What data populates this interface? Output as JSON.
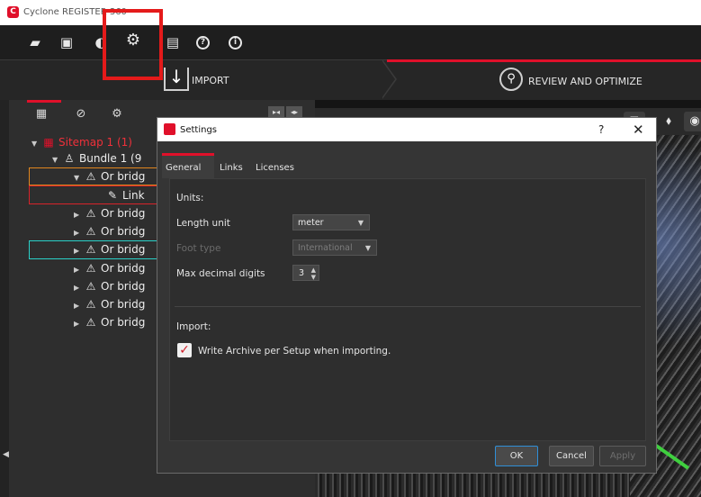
{
  "app": {
    "title": "Cyclone REGISTER 360"
  },
  "toolbar": {
    "icons": [
      "folder-open-icon",
      "archive-icon",
      "half-circle-icon",
      "settings-gear-icon",
      "document-icon",
      "help-icon",
      "info-icon"
    ]
  },
  "workflow": {
    "import_label": "IMPORT",
    "review_label": "REVIEW AND OPTIMIZE"
  },
  "tree": {
    "sitemap": "Sitemap 1 (1)",
    "bundle": "Bundle 1 (9",
    "items": [
      {
        "label": "Or bridg",
        "expanded": true
      },
      {
        "label": "Link",
        "type": "link"
      },
      {
        "label": "Or bridg"
      },
      {
        "label": "Or bridg"
      },
      {
        "label": "Or bridg"
      },
      {
        "label": "Or bridg"
      },
      {
        "label": "Or bridg"
      },
      {
        "label": "Or bridg"
      },
      {
        "label": "Or bridg"
      }
    ]
  },
  "dialog": {
    "title": "Settings",
    "help": "?",
    "close": "✕",
    "tabs": [
      "General",
      "Links",
      "Licenses"
    ],
    "units_header": "Units:",
    "length_unit_label": "Length unit",
    "length_unit_value": "meter",
    "foot_type_label": "Foot type",
    "foot_type_value": "International",
    "max_decimal_label": "Max decimal digits",
    "max_decimal_value": "3",
    "import_header": "Import:",
    "write_archive_label": "Write Archive per Setup when importing.",
    "write_archive_checked": true,
    "buttons": {
      "ok": "OK",
      "cancel": "Cancel",
      "apply": "Apply"
    }
  },
  "colors": {
    "accent_red": "#e0102a",
    "highlight_red": "#e41a1a",
    "selection_orange": "#e0861e",
    "selection_cyan": "#2ad0c8"
  }
}
